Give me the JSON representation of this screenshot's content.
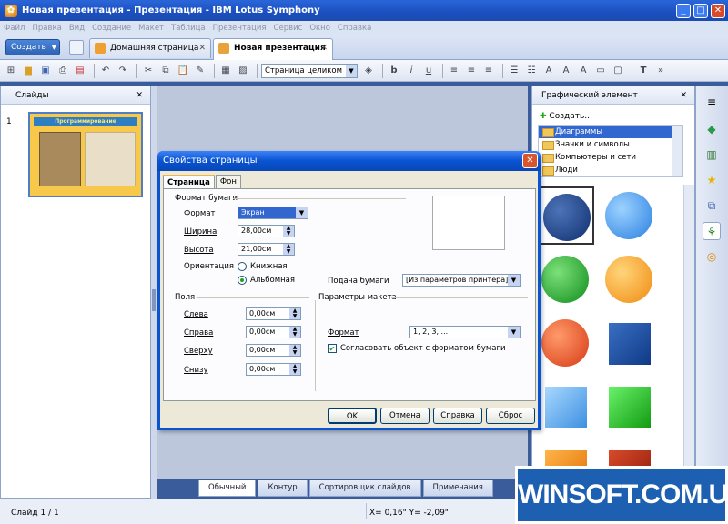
{
  "window": {
    "title": "Новая презентация - Презентация - IBM Lotus Symphony"
  },
  "menu": [
    "Файл",
    "Правка",
    "Вид",
    "Создание",
    "Макет",
    "Таблица",
    "Презентация",
    "Сервис",
    "Окно",
    "Справка"
  ],
  "tabbar": {
    "new_button": "Создать",
    "tabs": [
      {
        "label": "Домашняя страница"
      },
      {
        "label": "Новая презентация"
      }
    ]
  },
  "toolbar": {
    "view_select": "Страница целиком"
  },
  "slides_panel": {
    "title": "Слайды",
    "slide_number": "1",
    "thumb_title": "Программирование"
  },
  "graphics_panel": {
    "title": "Графический элемент",
    "create": "Создать...",
    "categories": [
      "Диаграммы",
      "Значки и символы",
      "Компьютеры и сети",
      "Люди"
    ]
  },
  "bottom_tabs": [
    "Обычный",
    "Контур",
    "Сортировщик слайдов",
    "Примечания"
  ],
  "status": {
    "slide": "Слайд 1 / 1",
    "coords": "X= 0,16\" Y= -2,09\""
  },
  "dialog": {
    "title": "Свойства страницы",
    "tabs": [
      "Страница",
      "Фон"
    ],
    "paper_format_section": "Формат бумаги",
    "format_label": "Формат",
    "format_value": "Экран",
    "width_label": "Ширина",
    "width_value": "28,00см",
    "height_label": "Высота",
    "height_value": "21,00см",
    "orientation_label": "Ориентация",
    "portrait": "Книжная",
    "landscape": "Альбомная",
    "paper_tray_label": "Подача бумаги",
    "paper_tray_value": "[Из параметров принтера]",
    "margins_section": "Поля",
    "left_label": "Слева",
    "left_value": "0,00см",
    "right_label": "Справа",
    "right_value": "0,00см",
    "top_label": "Сверху",
    "top_value": "0,00см",
    "bottom_label": "Снизу",
    "bottom_value": "0,00см",
    "layout_section": "Параметры макета",
    "numbering_label": "Формат",
    "numbering_value": "1, 2, 3, ...",
    "fit_checkbox": "Согласовать объект с форматом бумаги",
    "ok": "OK",
    "cancel": "Отмена",
    "help": "Справка",
    "reset": "Сброс"
  },
  "watermark": "WINSOFT.COM.UA",
  "colors": {
    "accent": "#0a53d1",
    "titlebar": "#1a4fbf"
  }
}
